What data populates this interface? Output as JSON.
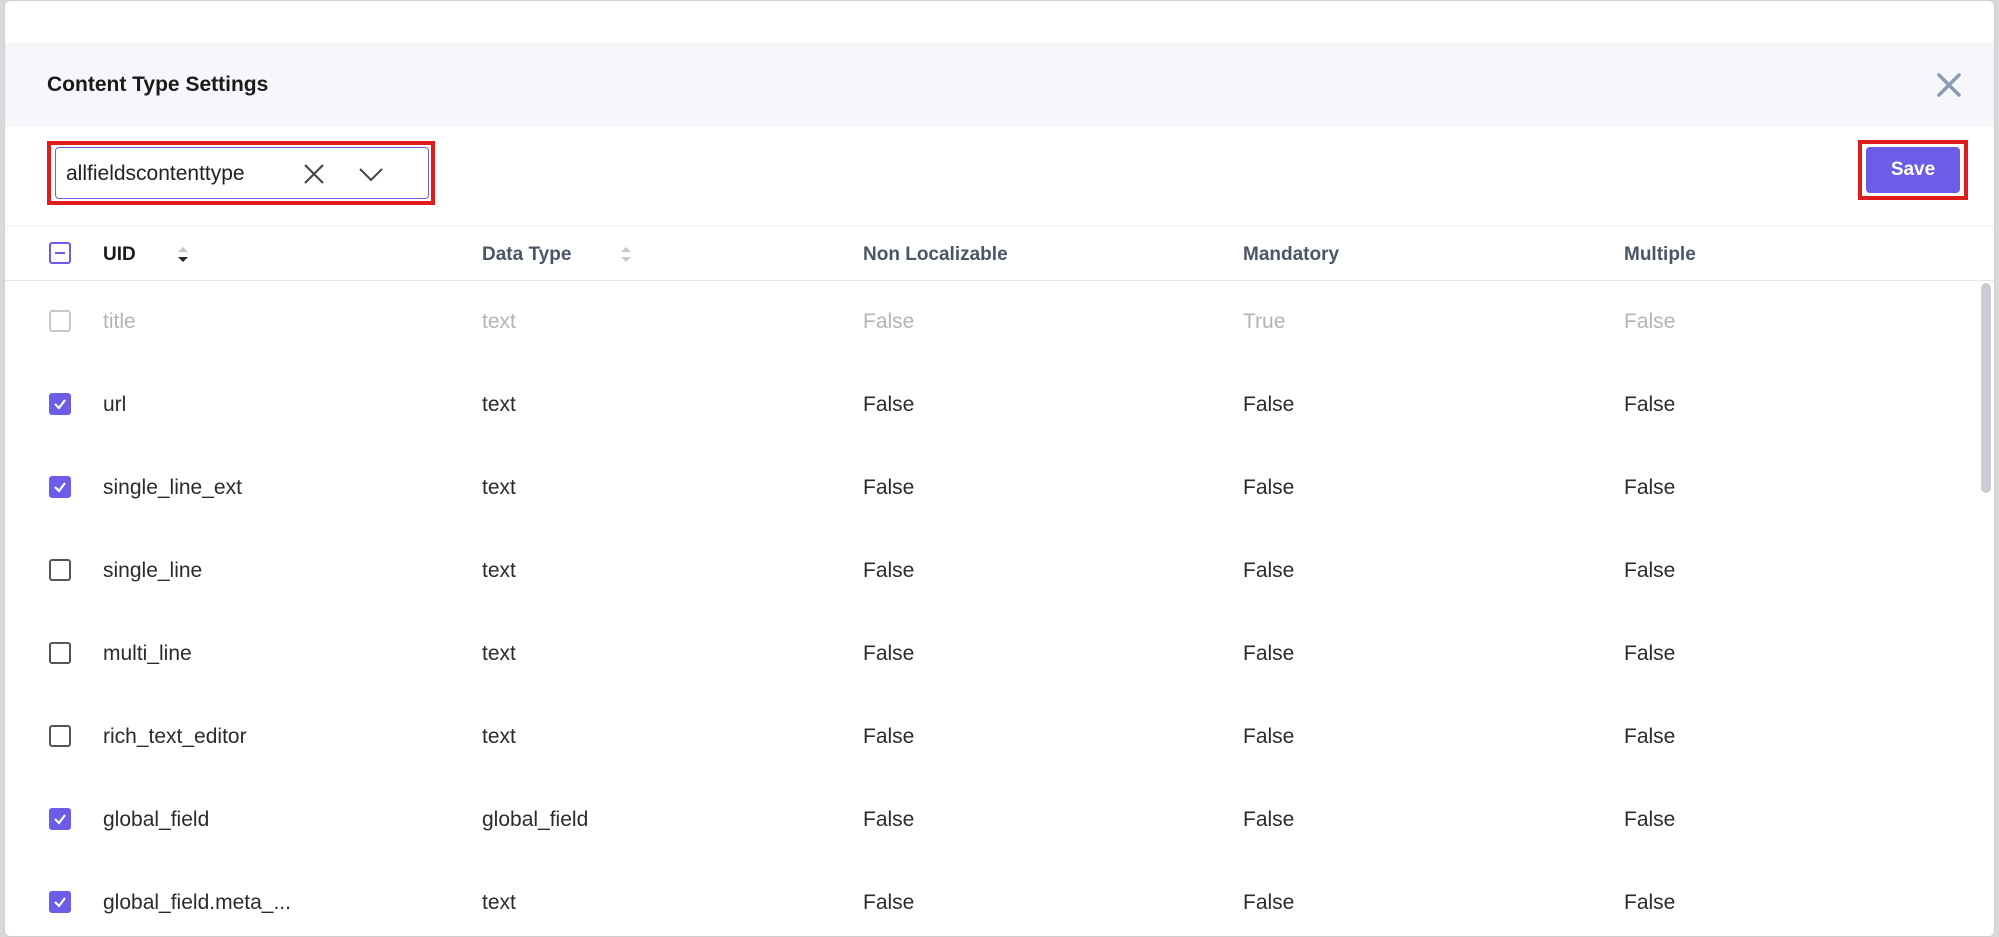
{
  "modal": {
    "title": "Content Type Settings"
  },
  "toolbar": {
    "content_type_value": "allfieldscontenttype",
    "save_label": "Save"
  },
  "table": {
    "headers": [
      "UID",
      "Data Type",
      "Non Localizable",
      "Mandatory",
      "Multiple"
    ],
    "rows": [
      {
        "uid": "title",
        "data_type": "text",
        "non_localizable": "False",
        "mandatory": "True",
        "multiple": "False",
        "checked": false,
        "disabled": true
      },
      {
        "uid": "url",
        "data_type": "text",
        "non_localizable": "False",
        "mandatory": "False",
        "multiple": "False",
        "checked": true,
        "disabled": false
      },
      {
        "uid": "single_line_ext",
        "data_type": "text",
        "non_localizable": "False",
        "mandatory": "False",
        "multiple": "False",
        "checked": true,
        "disabled": false
      },
      {
        "uid": "single_line",
        "data_type": "text",
        "non_localizable": "False",
        "mandatory": "False",
        "multiple": "False",
        "checked": false,
        "disabled": false
      },
      {
        "uid": "multi_line",
        "data_type": "text",
        "non_localizable": "False",
        "mandatory": "False",
        "multiple": "False",
        "checked": false,
        "disabled": false
      },
      {
        "uid": "rich_text_editor",
        "data_type": "text",
        "non_localizable": "False",
        "mandatory": "False",
        "multiple": "False",
        "checked": false,
        "disabled": false
      },
      {
        "uid": "global_field",
        "data_type": "global_field",
        "non_localizable": "False",
        "mandatory": "False",
        "multiple": "False",
        "checked": true,
        "disabled": false
      },
      {
        "uid": "global_field.meta_...",
        "data_type": "text",
        "non_localizable": "False",
        "mandatory": "False",
        "multiple": "False",
        "checked": true,
        "disabled": false
      }
    ]
  },
  "colors": {
    "accent": "#6c5ce7",
    "highlight": "#e01b1b",
    "header_bg": "#f6f7fb"
  },
  "icons": {
    "close": "close-icon",
    "clear": "clear-icon",
    "chevron": "chevron-down-icon",
    "sort": "sort-icon",
    "check": "checkmark-icon"
  }
}
